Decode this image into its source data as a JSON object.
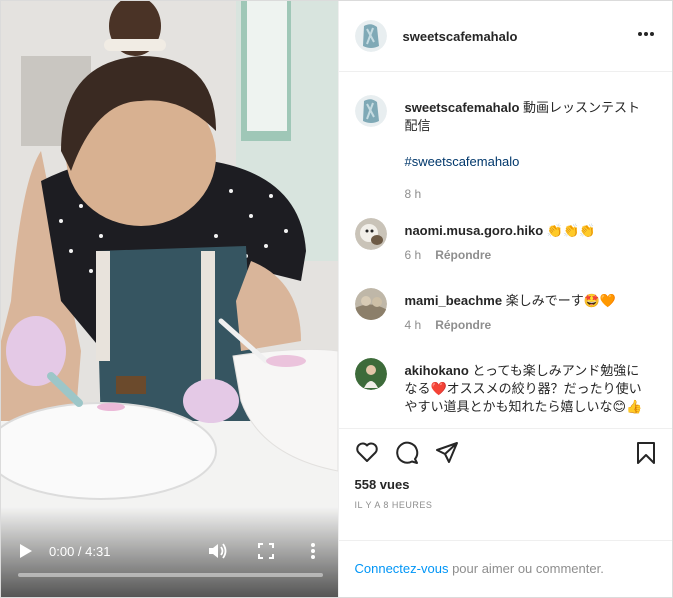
{
  "header": {
    "username": "sweetscafemahalo",
    "more_label": "•••"
  },
  "video": {
    "time": "0:00 / 4:31",
    "progress": 0,
    "icons": [
      "play-icon",
      "volume-icon",
      "fullscreen-icon",
      "more-vertical-icon"
    ]
  },
  "caption": {
    "username": "sweetscafemahalo",
    "text": "動画レッスンテスト配信",
    "hashtag": "#sweetscafemahalo",
    "time": "8 h"
  },
  "comments": [
    {
      "username": "naomi.musa.goro.hiko",
      "text": "👏👏👏",
      "time": "6 h",
      "reply_label": "Répondre"
    },
    {
      "username": "mami_beachme",
      "text": "楽しみでーす🤩🧡",
      "time": "4 h",
      "reply_label": "Répondre"
    },
    {
      "username": "akihokano",
      "text": "とっても楽しみアンド勉強になる❤️オススメの絞り器？だったり使いやすい道具とかも知れたら嬉しいな😊👍"
    }
  ],
  "actions": {
    "icons": [
      "heart-icon",
      "comment-icon",
      "share-icon",
      "bookmark-icon"
    ],
    "views": "558 vues",
    "ago": "IL Y A 8 HEURES"
  },
  "login": {
    "link": "Connectez-vous",
    "text": " pour aimer ou commenter."
  },
  "colors": {
    "link": "#0095f6",
    "hashtag": "#00376b",
    "muted": "#8e8e8e",
    "text": "#262626"
  }
}
